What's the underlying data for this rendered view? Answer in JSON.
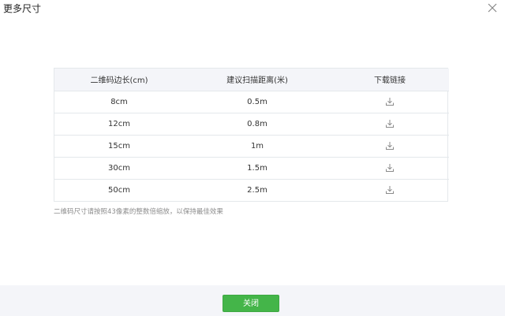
{
  "dialog": {
    "title": "更多尺寸",
    "close_icon": "close-icon"
  },
  "table": {
    "headers": [
      "二维码边长(cm)",
      "建议扫描距离(米)",
      "下载链接"
    ],
    "rows": [
      {
        "size": "8cm",
        "distance": "0.5m",
        "icon": "download-icon"
      },
      {
        "size": "12cm",
        "distance": "0.8m",
        "icon": "download-icon"
      },
      {
        "size": "15cm",
        "distance": "1m",
        "icon": "download-icon"
      },
      {
        "size": "30cm",
        "distance": "1.5m",
        "icon": "download-icon"
      },
      {
        "size": "50cm",
        "distance": "2.5m",
        "icon": "download-icon"
      }
    ]
  },
  "note": "二维码尺寸请按照43像素的整数倍缩放，以保持最佳效果",
  "footer": {
    "close_label": "关闭",
    "button_color": "#44b549"
  }
}
